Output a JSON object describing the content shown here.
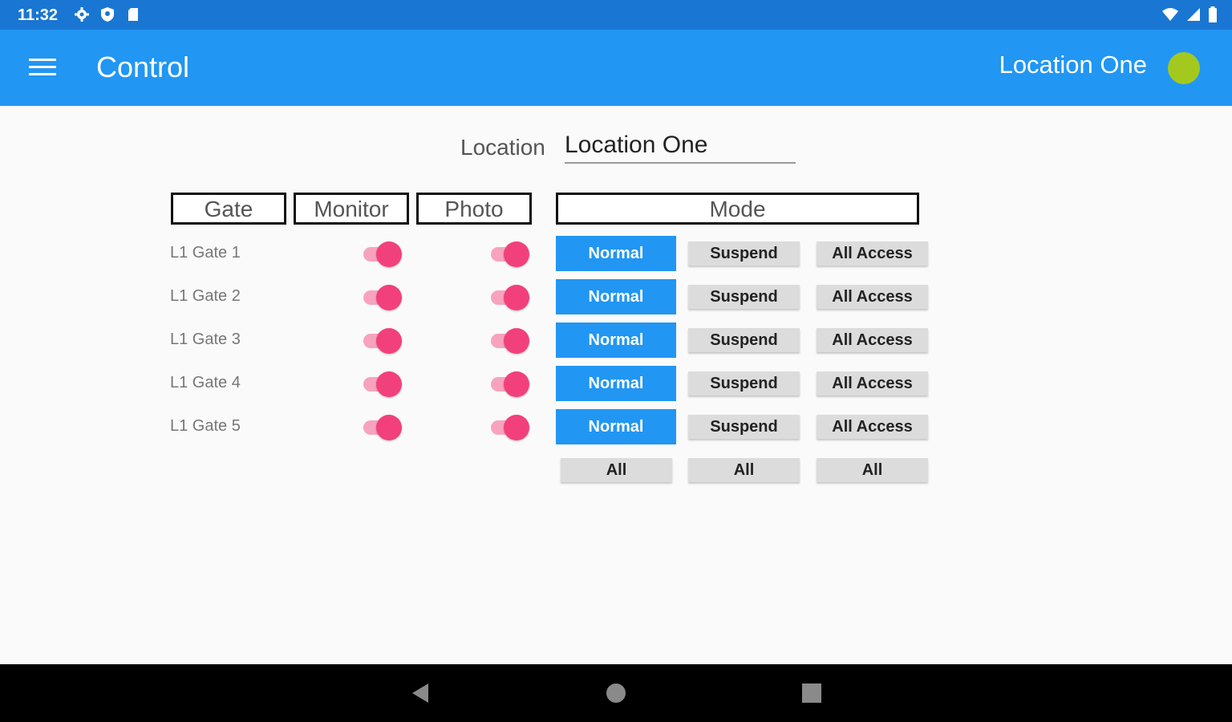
{
  "status_bar": {
    "time": "11:32",
    "left_icons": [
      "settings-icon",
      "shield-icon",
      "sd-card-icon"
    ],
    "right_icons": [
      "wifi-icon",
      "signal-icon",
      "battery-icon"
    ]
  },
  "app_bar": {
    "menu_icon": "hamburger-menu-icon",
    "title": "Control",
    "location": "Location One",
    "status_color": "#a4c91e"
  },
  "location_field": {
    "label": "Location",
    "value": "Location One"
  },
  "headers": {
    "gate": "Gate",
    "monitor": "Monitor",
    "photo": "Photo",
    "mode": "Mode"
  },
  "gates": [
    {
      "name": "L1 Gate 1",
      "monitor": true,
      "photo": true,
      "mode": "Normal"
    },
    {
      "name": "L1 Gate 2",
      "monitor": true,
      "photo": true,
      "mode": "Normal"
    },
    {
      "name": "L1 Gate 3",
      "monitor": true,
      "photo": true,
      "mode": "Normal"
    },
    {
      "name": "L1 Gate 4",
      "monitor": true,
      "photo": true,
      "mode": "Normal"
    },
    {
      "name": "L1 Gate 5",
      "monitor": true,
      "photo": true,
      "mode": "Normal"
    }
  ],
  "mode_buttons": {
    "normal": "Normal",
    "suspend": "Suspend",
    "all_access": "All Access"
  },
  "all_buttons": [
    "All",
    "All",
    "All"
  ],
  "colors": {
    "primary": "#2196f3",
    "status_bar": "#1976d2",
    "switch_on": "#f2407c"
  },
  "nav_bar": [
    "back-icon",
    "home-icon",
    "recents-icon"
  ]
}
